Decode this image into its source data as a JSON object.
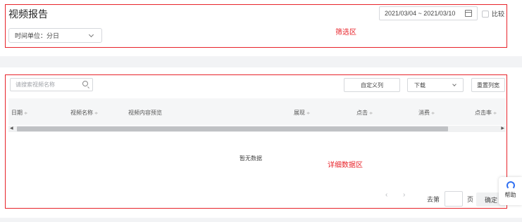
{
  "header": {
    "title": "视频报告",
    "date_range": "2021/03/04 ~ 2021/03/10",
    "compare_label": "比较",
    "time_unit": "时间单位：分日"
  },
  "toolbar": {
    "search_placeholder": "请搜索视频名称",
    "custom_columns_label": "自定义列",
    "download_label": "下载",
    "reset_columns_label": "重置列宽"
  },
  "table": {
    "columns": [
      "日期",
      "视频名称",
      "视频内容预览",
      "展现",
      "点击",
      "消费",
      "点击率"
    ],
    "sort_marker": "≑",
    "empty_text": "暂无数据"
  },
  "pagination": {
    "prev": "‹",
    "next": "›",
    "goto_label": "去第",
    "page_suffix": "页",
    "confirm_label": "确定"
  },
  "help": {
    "label": "帮助"
  },
  "annotations": {
    "filter_area": "筛选区",
    "detail_area": "详细数据区",
    "color": "#e8232a"
  }
}
